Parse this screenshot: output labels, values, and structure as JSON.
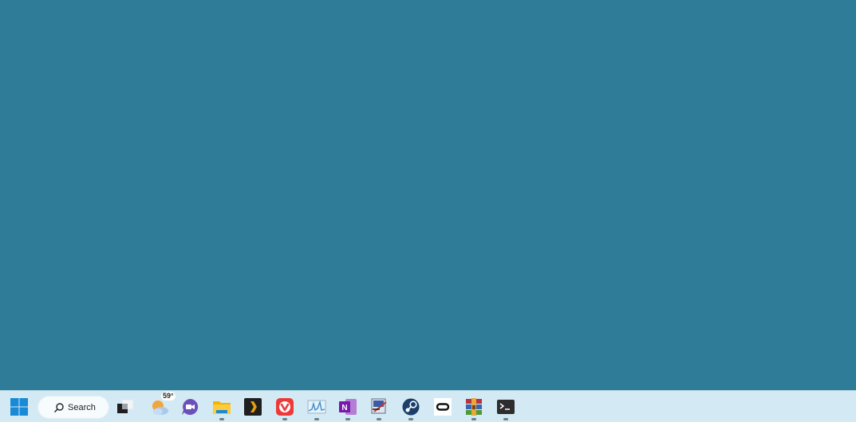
{
  "desktop": {
    "background_color": "#2e7c97"
  },
  "taskbar": {
    "background_color": "#d3e9f3",
    "start_button": {
      "icon": "windows-logo-icon"
    },
    "search": {
      "label": "Search",
      "icon": "search-icon"
    },
    "weather": {
      "temperature": "59°",
      "icon": "weather-partly-cloudy-icon"
    },
    "apps": [
      {
        "name": "task-view",
        "icon": "task-view-icon",
        "running": false
      },
      {
        "name": "weather-widget",
        "icon": "weather-partly-cloudy-icon",
        "running": false
      },
      {
        "name": "teams-chat",
        "icon": "video-chat-icon",
        "running": false
      },
      {
        "name": "file-explorer",
        "icon": "folder-icon",
        "running": true
      },
      {
        "name": "plex",
        "icon": "plex-chevron-icon",
        "running": false
      },
      {
        "name": "vivaldi",
        "icon": "vivaldi-icon",
        "running": true
      },
      {
        "name": "resource-monitor",
        "icon": "graph-monitor-icon",
        "running": true
      },
      {
        "name": "onenote",
        "icon": "onenote-icon",
        "running": true
      },
      {
        "name": "snipping-editor",
        "icon": "pen-screen-icon",
        "running": true
      },
      {
        "name": "steam",
        "icon": "steam-icon",
        "running": true
      },
      {
        "name": "oculus",
        "icon": "oculus-icon",
        "running": false
      },
      {
        "name": "winrar",
        "icon": "winrar-icon",
        "running": true
      },
      {
        "name": "terminal",
        "icon": "terminal-icon",
        "running": true
      }
    ]
  }
}
